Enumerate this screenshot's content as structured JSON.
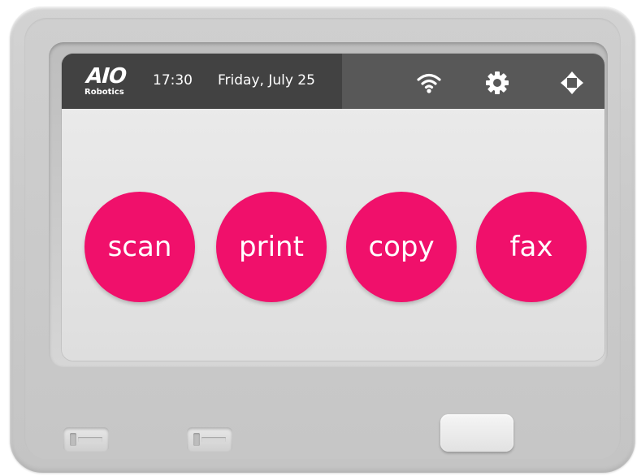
{
  "brand": {
    "logo_mark": "AIO",
    "logo_sub": "Robotics"
  },
  "status_bar": {
    "time": "17:30",
    "date": "Friday, July 25",
    "icons": [
      "wifi-icon",
      "gear-icon",
      "move-arrows-icon"
    ]
  },
  "actions": [
    {
      "label": "scan"
    },
    {
      "label": "print"
    },
    {
      "label": "copy"
    },
    {
      "label": "fax"
    }
  ],
  "colors": {
    "accent": "#f0106b",
    "statusbar_dark": "#424242",
    "statusbar": "#585858",
    "screen_bg": "#e8e8e8",
    "device_body": "#cbcbcb"
  }
}
